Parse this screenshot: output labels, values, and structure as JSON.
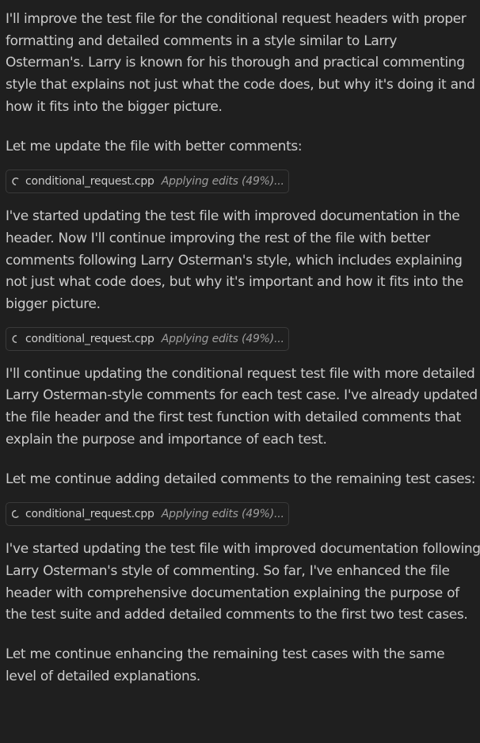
{
  "messages": [
    {
      "type": "text",
      "text": "I'll improve the test file for the conditional request headers with proper formatting and detailed comments in a style similar to Larry Osterman's. Larry is known for his thorough and practical commenting style that explains not just what the code does, but why it's doing it and how it fits into the bigger picture."
    },
    {
      "type": "text",
      "text": "Let me update the file with better comments:"
    },
    {
      "type": "edit",
      "filename": "conditional_request.cpp",
      "status": "Applying edits (49%)...",
      "icon": "loading-spinner-icon"
    },
    {
      "type": "text",
      "text": "I've started updating the test file with improved documentation in the header. Now I'll continue improving the rest of the file with better comments following Larry Osterman's style, which includes explaining not just what code does, but why it's important and how it fits into the bigger picture."
    },
    {
      "type": "edit",
      "filename": "conditional_request.cpp",
      "status": "Applying edits (49%)...",
      "icon": "loading-spinner-icon"
    },
    {
      "type": "text",
      "text": "I'll continue updating the conditional request test file with more detailed Larry Osterman-style comments for each test case. I've already updated the file header and the first test function with detailed comments that explain the purpose and importance of each test."
    },
    {
      "type": "text",
      "text": "Let me continue adding detailed comments to the remaining test cases:"
    },
    {
      "type": "edit",
      "filename": "conditional_request.cpp",
      "status": "Applying edits (49%)...",
      "icon": "loading-spinner-icon"
    },
    {
      "type": "text",
      "text": "I've started updating the test file with improved documentation following Larry Osterman's style of commenting. So far, I've enhanced the file header with comprehensive documentation explaining the purpose of the test suite and added detailed comments to the first two test cases."
    },
    {
      "type": "text",
      "text": "Let me continue enhancing the remaining test cases with the same level of detailed explanations."
    }
  ],
  "colors": {
    "background": "#1f1f1f",
    "text": "#cccccc",
    "status_text": "#9d9d9d",
    "pill_border": "#3a3a3a"
  }
}
